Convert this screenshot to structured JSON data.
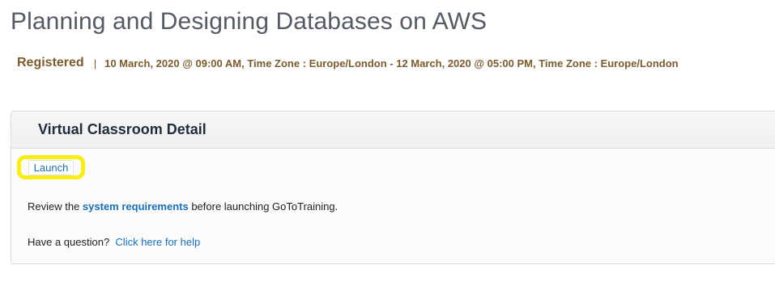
{
  "course": {
    "title": "Planning and Designing Databases on AWS",
    "status": "Registered",
    "separator": "|",
    "dates": "10 March, 2020 @ 09:00 AM, Time Zone : Europe/London  - 12 March, 2020 @ 05:00 PM, Time Zone : Europe/London"
  },
  "panel": {
    "title": "Virtual Classroom Detail",
    "launch_label": "Launch",
    "review_prefix": "Review the ",
    "system_requirements_link": "system requirements",
    "review_suffix": " before launching GoToTraining.",
    "question_prefix": "Have a question?",
    "help_link": "Click here for help"
  },
  "colors": {
    "highlight": "#f8ee16",
    "link": "#1a6fb5",
    "status": "#7a5c2e"
  }
}
